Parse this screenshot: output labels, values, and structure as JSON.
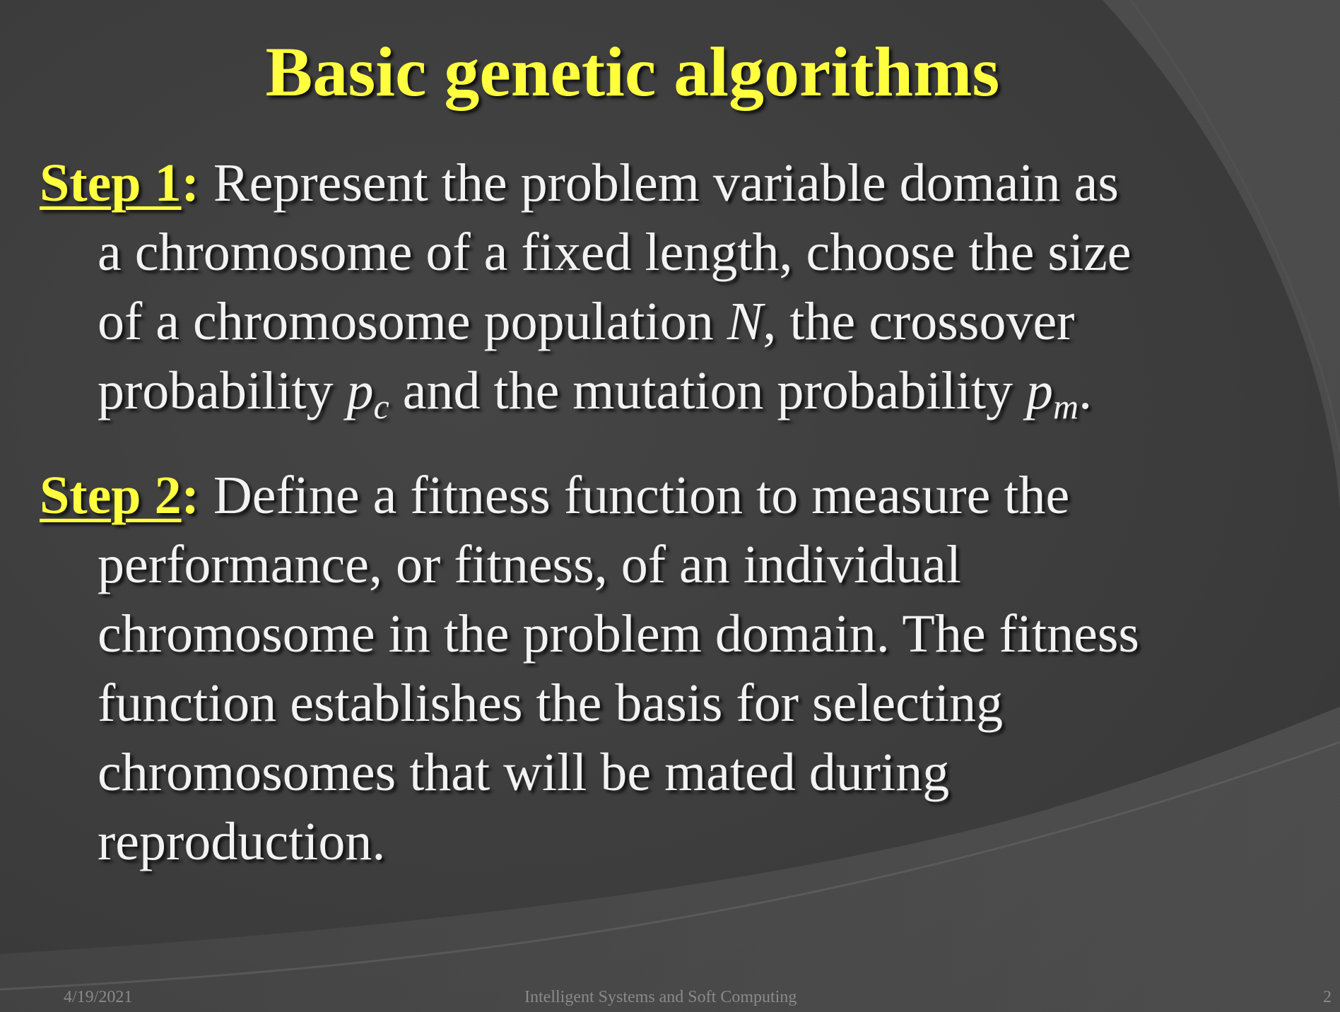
{
  "slide": {
    "title": "Basic genetic algorithms",
    "steps": [
      {
        "label": "Step 1",
        "colon": ":",
        "line1_text": "Represent the problem variable domain as",
        "line2": "a chromosome of a fixed length, choose the size",
        "line3_a": "of a chromosome population ",
        "line3_var": "N",
        "line3_b": ", the crossover",
        "line4_a": "probability ",
        "line4_var1": "p",
        "line4_sub1": "c",
        "line4_b": " and the mutation probability ",
        "line4_var2": "p",
        "line4_sub2": "m",
        "line4_c": "."
      },
      {
        "label": "Step 2",
        "colon": ":",
        "line1_text": "Define a fitness function to measure the",
        "line2": "performance, or fitness, of an individual",
        "line3": "chromosome in the problem domain. The fitness",
        "line4": "function establishes the basis for selecting",
        "line5": "chromosomes that will be mated during",
        "line6": "reproduction."
      }
    ],
    "footer": {
      "date": "4/19/2021",
      "center": "Intelligent Systems and Soft Computing",
      "page": "2"
    },
    "colors": {
      "background": "#3d3d3d",
      "title": "#ffff40",
      "text": "#f2f2f2",
      "footer": "#8a8a8a"
    }
  }
}
